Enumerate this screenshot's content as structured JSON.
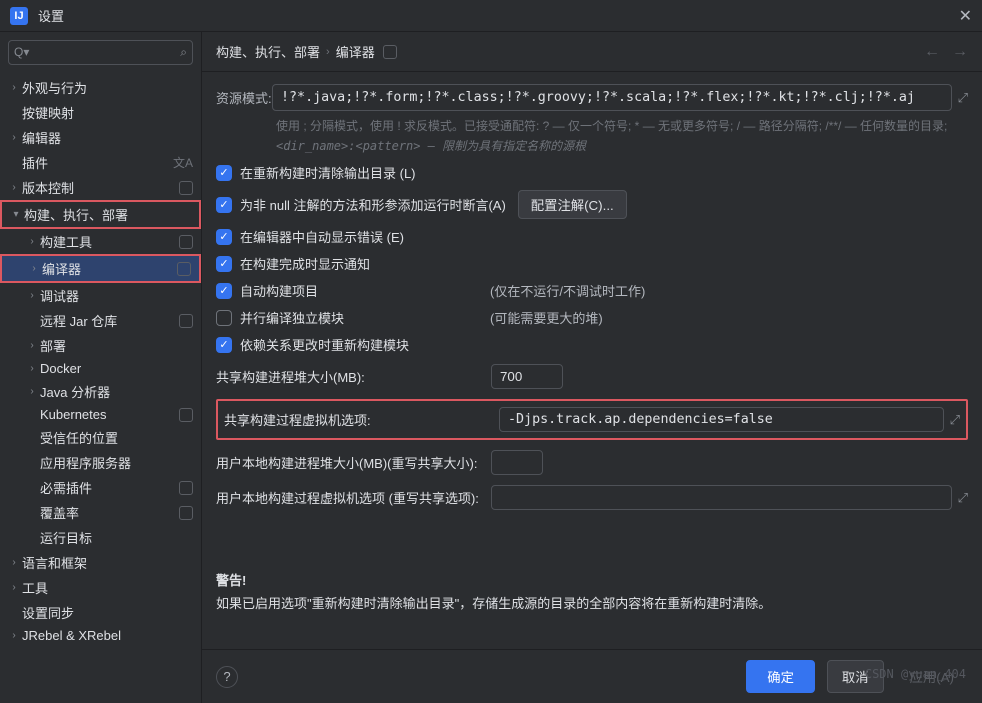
{
  "window": {
    "title": "设置"
  },
  "search": {
    "placeholder": "",
    "query": ""
  },
  "sidebar": {
    "items": [
      {
        "label": "外观与行为",
        "depth": 0,
        "arrow": "right",
        "badge": false
      },
      {
        "label": "按键映射",
        "depth": 0,
        "arrow": "",
        "badge": false
      },
      {
        "label": "编辑器",
        "depth": 0,
        "arrow": "right",
        "badge": false
      },
      {
        "label": "插件",
        "depth": 0,
        "arrow": "",
        "badge": false,
        "extra": "lang"
      },
      {
        "label": "版本控制",
        "depth": 0,
        "arrow": "right",
        "badge": true
      },
      {
        "label": "构建、执行、部署",
        "depth": 0,
        "arrow": "down",
        "badge": false,
        "hl": true
      },
      {
        "label": "构建工具",
        "depth": 1,
        "arrow": "right",
        "badge": true
      },
      {
        "label": "编译器",
        "depth": 1,
        "arrow": "right",
        "badge": true,
        "selected": true,
        "hl": true
      },
      {
        "label": "调试器",
        "depth": 1,
        "arrow": "right",
        "badge": false
      },
      {
        "label": "远程 Jar 仓库",
        "depth": 1,
        "arrow": "",
        "badge": true
      },
      {
        "label": "部署",
        "depth": 1,
        "arrow": "right",
        "badge": false
      },
      {
        "label": "Docker",
        "depth": 1,
        "arrow": "right",
        "badge": false
      },
      {
        "label": "Java 分析器",
        "depth": 1,
        "arrow": "right",
        "badge": false
      },
      {
        "label": "Kubernetes",
        "depth": 1,
        "arrow": "",
        "badge": true
      },
      {
        "label": "受信任的位置",
        "depth": 1,
        "arrow": "",
        "badge": false
      },
      {
        "label": "应用程序服务器",
        "depth": 1,
        "arrow": "",
        "badge": false
      },
      {
        "label": "必需插件",
        "depth": 1,
        "arrow": "",
        "badge": true
      },
      {
        "label": "覆盖率",
        "depth": 1,
        "arrow": "",
        "badge": true
      },
      {
        "label": "运行目标",
        "depth": 1,
        "arrow": "",
        "badge": false
      },
      {
        "label": "语言和框架",
        "depth": 0,
        "arrow": "right",
        "badge": false
      },
      {
        "label": "工具",
        "depth": 0,
        "arrow": "right",
        "badge": false
      },
      {
        "label": "设置同步",
        "depth": 0,
        "arrow": "",
        "badge": false
      },
      {
        "label": "JRebel & XRebel",
        "depth": 0,
        "arrow": "right",
        "badge": false
      }
    ]
  },
  "breadcrumb": {
    "a": "构建、执行、部署",
    "b": "编译器"
  },
  "main": {
    "resource_label": "资源模式:",
    "resource_value": "!?*.java;!?*.form;!?*.class;!?*.groovy;!?*.scala;!?*.flex;!?*.kt;!?*.clj;!?*.aj",
    "resource_hint1": "使用 ; 分隔模式，使用 ! 求反模式。已接受通配符: ? — 仅一个符号; * — 无或更多符号; / — 路径分隔符; /**/ — 任何数量的目录;",
    "resource_hint2": "<dir_name>:<pattern> — 限制为具有指定名称的源根",
    "chk_clear": "在重新构建时清除输出目录 (L)",
    "chk_null": "为非 null 注解的方法和形参添加运行时断言(A)",
    "btn_configure": "配置注解(C)...",
    "chk_errors": "在编辑器中自动显示错误 (E)",
    "chk_notify": "在构建完成时显示通知",
    "chk_auto": "自动构建项目",
    "note_auto": "(仅在不运行/不调试时工作)",
    "chk_parallel": "并行编译独立模块",
    "note_parallel": "(可能需要更大的堆)",
    "chk_deps": "依赖关系更改时重新构建模块",
    "heap_label": "共享构建进程堆大小(MB):",
    "heap_value": "700",
    "vmopt_label": "共享构建过程虚拟机选项:",
    "vmopt_value": "-Djps.track.ap.dependencies=false",
    "local_heap_label": "用户本地构建进程堆大小(MB)(重写共享大小):",
    "local_heap_value": "",
    "local_vmopt_label": "用户本地构建过程虚拟机选项 (重写共享选项):",
    "local_vmopt_value": "",
    "warning_title": "警告!",
    "warning_body": "如果已启用选项\"重新构建时清除输出目录\"，存储生成源的目录的全部内容将在重新构建时清除。"
  },
  "footer": {
    "ok": "确定",
    "cancel": "取消",
    "apply": "应用(A)"
  },
  "watermark": "CSDN @yuan_404"
}
